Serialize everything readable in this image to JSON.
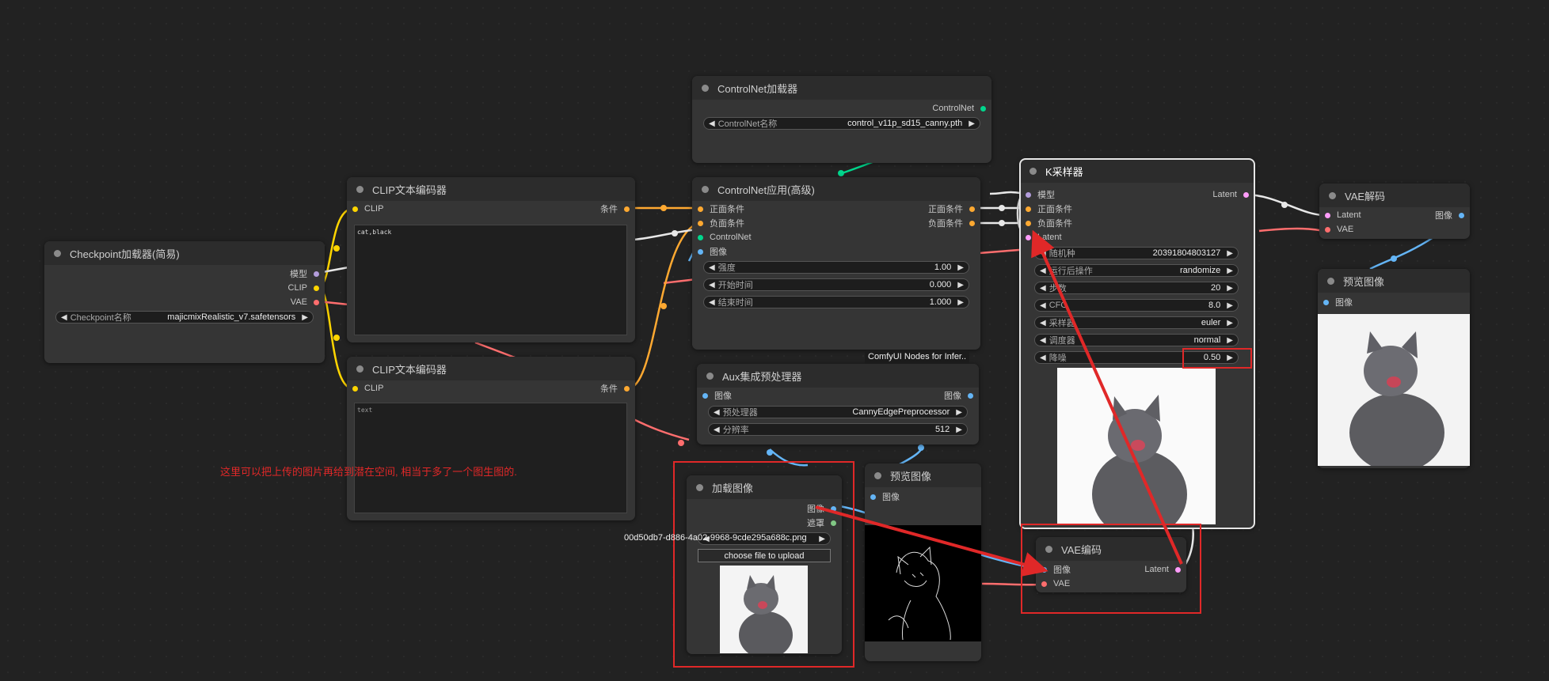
{
  "colors": {
    "model": "#b39ddb",
    "clip": "#ffd500",
    "vae": "#ff6e6e",
    "conditioning": "#ffa931",
    "controlnet": "#00d78d",
    "image": "#64b5f6",
    "latent": "#ff9cf9",
    "mask": "#81c784",
    "annotation": "#e02828"
  },
  "arrow_glyphs": {
    "left": "◀",
    "right": "▶"
  },
  "checkpoint": {
    "title": "Checkpoint加载器(简易)",
    "outputs": [
      "模型",
      "CLIP",
      "VAE"
    ],
    "widget_label": "Checkpoint名称",
    "widget_value": "majicmixRealistic_v7.safetensors"
  },
  "clip_pos": {
    "title": "CLIP文本编码器",
    "input": "CLIP",
    "output": "条件",
    "text": "cat,black"
  },
  "clip_neg": {
    "title": "CLIP文本编码器",
    "input": "CLIP",
    "output": "条件",
    "text": "text"
  },
  "cn_loader": {
    "title": "ControlNet加载器",
    "output": "ControlNet",
    "widget_label": "ControlNet名称",
    "widget_value": "control_v11p_sd15_canny.pth"
  },
  "cn_apply": {
    "title": "ControlNet应用(高级)",
    "inputs": [
      "正面条件",
      "负面条件",
      "ControlNet",
      "图像"
    ],
    "outputs": [
      "正面条件",
      "负面条件"
    ],
    "widgets": [
      {
        "label": "强度",
        "value": "1.00"
      },
      {
        "label": "开始时间",
        "value": "0.000"
      },
      {
        "label": "结束时间",
        "value": "1.000"
      }
    ]
  },
  "badge": "ComfyUI Nodes for Infer..",
  "aux": {
    "title": "Aux集成预处理器",
    "input": "图像",
    "output": "图像",
    "widgets": [
      {
        "label": "预处理器",
        "value": "CannyEdgePreprocessor"
      },
      {
        "label": "分辨率",
        "value": "512"
      }
    ]
  },
  "load_image": {
    "title": "加载图像",
    "outputs": [
      "图像",
      "遮罩"
    ],
    "filename": "00d50db7-d886-4a02-9968-9cde295a688c.png",
    "upload_label": "choose file to upload"
  },
  "preview_mid": {
    "title": "预览图像",
    "input": "图像"
  },
  "ksampler": {
    "title": "K采样器",
    "inputs": [
      "模型",
      "正面条件",
      "负面条件",
      "Latent"
    ],
    "output": "Latent",
    "widgets": [
      {
        "label": "随机种",
        "value": "20391804803127"
      },
      {
        "label": "运行后操作",
        "value": "randomize"
      },
      {
        "label": "步数",
        "value": "20"
      },
      {
        "label": "CFG",
        "value": "8.0"
      },
      {
        "label": "采样器",
        "value": "euler"
      },
      {
        "label": "调度器",
        "value": "normal"
      },
      {
        "label": "降噪",
        "value": "0.50"
      }
    ]
  },
  "vae_decode": {
    "title": "VAE解码",
    "inputs": [
      "Latent",
      "VAE"
    ],
    "output": "图像"
  },
  "preview_right": {
    "title": "预览图像",
    "input": "图像"
  },
  "vae_encode": {
    "title": "VAE编码",
    "inputs": [
      "图像",
      "VAE"
    ],
    "output": "Latent"
  },
  "annotation": "这里可以把上传的图片再给到潜在空间, 相当于多了一个图生图的."
}
